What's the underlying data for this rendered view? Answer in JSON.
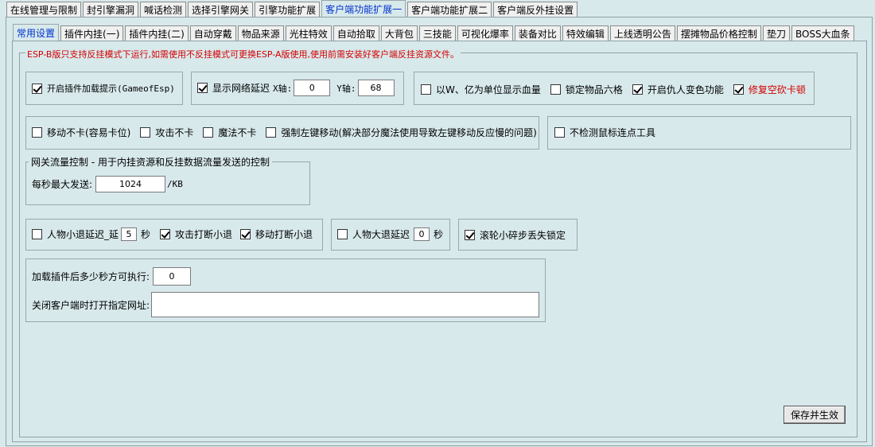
{
  "top_tabs": [
    "在线管理与限制",
    "封引擎漏洞",
    "喊话检测",
    "选择引擎网关",
    "引擎功能扩展",
    "客户端功能扩展一",
    "客户端功能扩展二",
    "客户端反外挂设置"
  ],
  "sub_tabs": [
    "常用设置",
    "插件内挂(一)",
    "插件内挂(二)",
    "自动穿戴",
    "物品来源",
    "光柱特效",
    "自动拾取",
    "大背包",
    "三技能",
    "可视化爆率",
    "装备对比",
    "特效编辑",
    "上线透明公告",
    "摆摊物品价格控制",
    "垫刀",
    "BOSS大血条"
  ],
  "warning": "ESP-B版只支持反挂模式下运行,如需使用不反挂模式可更换ESP-A版使用,使用前需安装好客户端反挂资源文件。",
  "group1": {
    "label": "开启插件加载提示(GameofEsp)",
    "checked": true
  },
  "group2": {
    "label": "显示网络延迟",
    "checked": true,
    "x_label": "X轴:",
    "x_value": "0",
    "y_label": "Y轴:",
    "y_value": "68"
  },
  "group3": [
    {
      "label": "以W、亿为单位显示血量",
      "checked": false,
      "red": false
    },
    {
      "label": "锁定物品六格",
      "checked": false,
      "red": false
    },
    {
      "label": "开启仇人变色功能",
      "checked": true,
      "red": false
    },
    {
      "label": "修复空砍卡顿",
      "checked": true,
      "red": true
    }
  ],
  "group4": [
    {
      "label": "移动不卡(容易卡位)",
      "checked": false
    },
    {
      "label": "攻击不卡",
      "checked": false
    },
    {
      "label": "魔法不卡",
      "checked": false
    },
    {
      "label": "强制左键移动(解决部分魔法使用导致左键移动反应慢的问题)",
      "checked": false
    }
  ],
  "group5": {
    "label": "不检测鼠标连点工具",
    "checked": false
  },
  "gateway": {
    "legend": "网关流量控制 - 用于内挂资源和反挂数据流量发送的控制",
    "label": "每秒最大发送:",
    "value": "1024",
    "unit": "/KB"
  },
  "retreat": {
    "small_label": "人物小退延迟_延",
    "small_checked": false,
    "small_value": "5",
    "sec": "秒",
    "attack_break": "攻击打断小退",
    "attack_checked": true,
    "move_break": "移动打断小退",
    "move_checked": true
  },
  "big_retreat": {
    "label": "人物大退延迟",
    "checked": false,
    "value": "0",
    "sec": "秒"
  },
  "wheel": {
    "label": "滚轮小碎步丢失锁定",
    "checked": true
  },
  "plugin": {
    "delay_label": "加载插件后多少秒方可执行:",
    "delay_value": "0",
    "url_label": "关闭客户端时打开指定网址:",
    "url_value": ""
  },
  "save_button": "保存并生效"
}
